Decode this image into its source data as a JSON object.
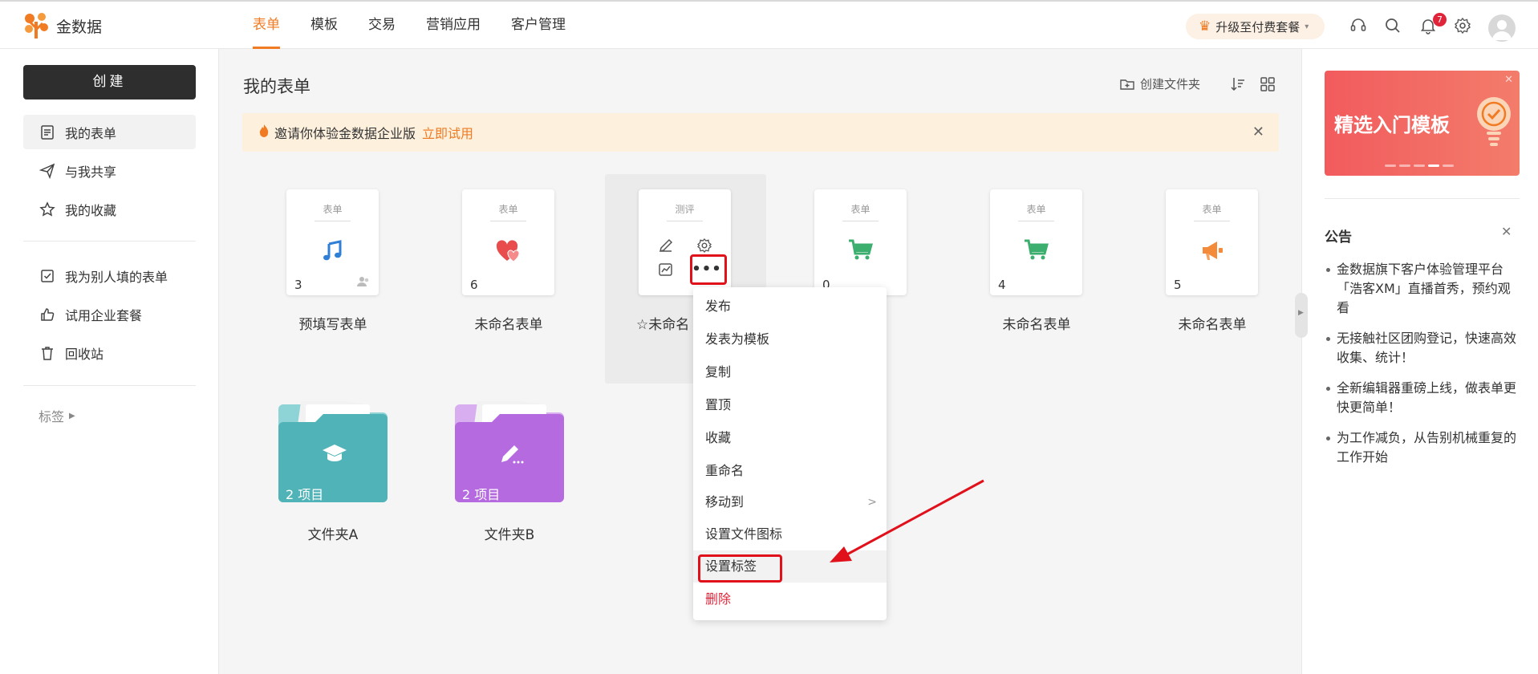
{
  "app": {
    "name": "金数据"
  },
  "nav": {
    "items": [
      "表单",
      "模板",
      "交易",
      "营销应用",
      "客户管理"
    ],
    "active": "表单"
  },
  "header": {
    "upgrade_label": "升级至付费套餐",
    "notification_count": "7"
  },
  "sidebar": {
    "create_label": "创建",
    "items": [
      {
        "label": "我的表单",
        "icon": "form-icon",
        "active": true
      },
      {
        "label": "与我共享",
        "icon": "send-icon",
        "active": false
      },
      {
        "label": "我的收藏",
        "icon": "star-icon",
        "active": false
      },
      {
        "label": "我为别人填的表单",
        "icon": "checkbox-icon",
        "active": false
      },
      {
        "label": "试用企业套餐",
        "icon": "thumbs-up-icon",
        "active": false
      },
      {
        "label": "回收站",
        "icon": "trash-icon",
        "active": false
      }
    ],
    "tags_label": "标签"
  },
  "main": {
    "title": "我的表单",
    "create_folder_label": "创建文件夹",
    "banner": {
      "text": "邀请你体验金数据企业版",
      "link": "立即试用"
    },
    "forms": [
      {
        "type": "表单",
        "icon": "music-note-icon",
        "count": "3",
        "label": "预填写表单"
      },
      {
        "type": "表单",
        "icon": "heart-icon",
        "count": "6",
        "label": "未命名表单"
      },
      {
        "type": "测评",
        "icon": "",
        "count": "",
        "label": "☆未命名"
      },
      {
        "type": "表单",
        "icon": "cart-icon",
        "count": "0",
        "label": "单"
      },
      {
        "type": "表单",
        "icon": "cart-icon",
        "count": "4",
        "label": "未命名表单"
      },
      {
        "type": "表单",
        "icon": "megaphone-icon",
        "count": "5",
        "label": "未命名表单"
      }
    ],
    "folders": [
      {
        "label": "文件夹A",
        "count": "2 项目",
        "color": "#4fb3b8",
        "icon": "graduation-cap-icon"
      },
      {
        "label": "文件夹B",
        "count": "2 项目",
        "color": "#b56ae0",
        "icon": "pen-icon"
      }
    ]
  },
  "context_menu": {
    "items": [
      {
        "label": "发布"
      },
      {
        "label": "发表为模板"
      },
      {
        "label": "复制"
      },
      {
        "label": "置顶"
      },
      {
        "label": "收藏"
      },
      {
        "label": "重命名"
      },
      {
        "label": "移动到",
        "arrow": ">"
      },
      {
        "label": "设置文件图标"
      },
      {
        "label": "设置标签",
        "highlighted": true
      },
      {
        "label": "删除",
        "danger": true
      }
    ]
  },
  "right_panel": {
    "promo_text": "精选入门模板",
    "announcement_title": "公告",
    "announcements": [
      "金数据旗下客户体验管理平台「浩客XM」直播首秀，预约观看",
      "无接触社区团购登记，快速高效收集、统计！",
      "全新编辑器重磅上线，做表单更快更简单！",
      "为工作减负，从告别机械重复的工作开始"
    ]
  },
  "colors": {
    "accent": "#f07b23",
    "danger": "#e0253a",
    "annotation_red": "#e0111b"
  }
}
